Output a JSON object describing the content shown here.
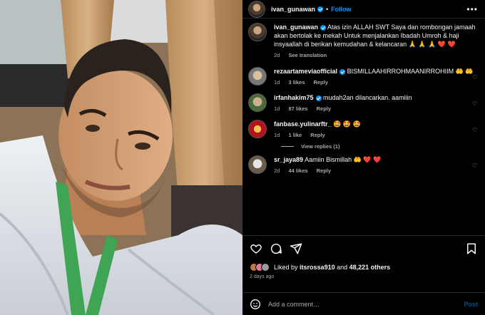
{
  "header": {
    "username": "ivan_gunawan",
    "separator": "•",
    "follow_label": "Follow",
    "more_label": "•••"
  },
  "caption": {
    "username": "ivan_gunawan",
    "text": "Atas izin ALLAH SWT Saya dan rombongan jamaah akan bertolak ke mekah Untuk menjalankan Ibadah Umroh & haji insyaallah di berikan kemudahan & kelancaran 🙏 🙏 🙏 ❤️ ❤️",
    "time": "2d",
    "translate_label": "See translation"
  },
  "comments": [
    {
      "username": "rezaartameviaofficial",
      "verified": true,
      "text": "BISMILLAAHIRROHMAANIRROHIIM",
      "emoji": "🤲 🤲",
      "time": "1d",
      "likes": "3 likes",
      "reply": "Reply"
    },
    {
      "username": "irfanhakim75",
      "verified": true,
      "text": "mudah2an dilancarkan. aamiiin",
      "emoji": "",
      "time": "1d",
      "likes": "87 likes",
      "reply": "Reply"
    },
    {
      "username": "fanbase.yulinarftr_",
      "verified": false,
      "text": "",
      "emoji": "🤩 🤩 🤩",
      "time": "1d",
      "likes": "1 like",
      "reply": "Reply"
    },
    {
      "username": "sr_jaya89",
      "verified": false,
      "text": "Aamiin Bismillah",
      "emoji": "🤲 ❤️ ❤️",
      "time": "2d",
      "likes": "44 likes",
      "reply": "Reply"
    }
  ],
  "view_replies": "View replies (1)",
  "likes": {
    "prefix": "Liked by",
    "user": "itsrossa910",
    "middle": "and",
    "count": "48,221 others"
  },
  "posted_ago": "2 days ago",
  "add_comment": {
    "placeholder": "Add a comment…",
    "post_label": "Post"
  },
  "icons": {
    "like": "heart-icon",
    "comment": "comment-icon",
    "share": "share-icon",
    "save": "bookmark-icon",
    "emoji": "smile-icon",
    "more": "more-dots-icon"
  },
  "colors": {
    "background": "#000000",
    "accent": "#0095f6",
    "muted": "#a8a8a8",
    "heart_red": "#ed4956"
  }
}
